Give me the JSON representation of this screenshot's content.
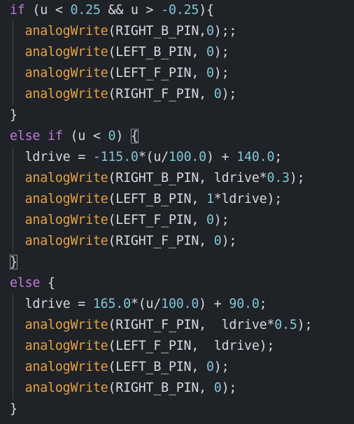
{
  "lines": [
    [
      {
        "t": "if",
        "c": "kw"
      },
      {
        "t": " (u < ",
        "c": "plain"
      },
      {
        "t": "0.25",
        "c": "num"
      },
      {
        "t": " && u > ",
        "c": "plain"
      },
      {
        "t": "-0.25",
        "c": "num"
      },
      {
        "t": "){",
        "c": "plain"
      }
    ],
    [
      {
        "t": "  ",
        "c": "plain"
      },
      {
        "t": "analogWrite",
        "c": "fn"
      },
      {
        "t": "(RIGHT_B_PIN,",
        "c": "plain"
      },
      {
        "t": "0",
        "c": "num"
      },
      {
        "t": ");;",
        "c": "plain"
      }
    ],
    [
      {
        "t": "  ",
        "c": "plain"
      },
      {
        "t": "analogWrite",
        "c": "fn"
      },
      {
        "t": "(LEFT_B_PIN, ",
        "c": "plain"
      },
      {
        "t": "0",
        "c": "num"
      },
      {
        "t": ");",
        "c": "plain"
      }
    ],
    [
      {
        "t": "  ",
        "c": "plain"
      },
      {
        "t": "analogWrite",
        "c": "fn"
      },
      {
        "t": "(LEFT_F_PIN, ",
        "c": "plain"
      },
      {
        "t": "0",
        "c": "num"
      },
      {
        "t": ");",
        "c": "plain"
      }
    ],
    [
      {
        "t": "  ",
        "c": "plain"
      },
      {
        "t": "analogWrite",
        "c": "fn"
      },
      {
        "t": "(RIGHT_F_PIN, ",
        "c": "plain"
      },
      {
        "t": "0",
        "c": "num"
      },
      {
        "t": ");",
        "c": "plain"
      }
    ],
    [
      {
        "t": "}",
        "c": "plain"
      }
    ],
    [
      {
        "t": "else",
        "c": "kw"
      },
      {
        "t": " ",
        "c": "plain"
      },
      {
        "t": "if",
        "c": "kw"
      },
      {
        "t": " (u < ",
        "c": "plain"
      },
      {
        "t": "0",
        "c": "num"
      },
      {
        "t": ") ",
        "c": "plain"
      },
      {
        "t": "{",
        "c": "plain",
        "m": true
      }
    ],
    [
      {
        "t": "  ldrive = ",
        "c": "plain"
      },
      {
        "t": "-115.0",
        "c": "num"
      },
      {
        "t": "*(u/",
        "c": "plain"
      },
      {
        "t": "100.0",
        "c": "num"
      },
      {
        "t": ") + ",
        "c": "plain"
      },
      {
        "t": "140.0",
        "c": "num"
      },
      {
        "t": ";",
        "c": "plain"
      }
    ],
    [
      {
        "t": "  ",
        "c": "plain"
      },
      {
        "t": "analogWrite",
        "c": "fn"
      },
      {
        "t": "(RIGHT_B_PIN, ldrive*",
        "c": "plain"
      },
      {
        "t": "0.3",
        "c": "num"
      },
      {
        "t": ");",
        "c": "plain"
      }
    ],
    [
      {
        "t": "  ",
        "c": "plain"
      },
      {
        "t": "analogWrite",
        "c": "fn"
      },
      {
        "t": "(LEFT_B_PIN, ",
        "c": "plain"
      },
      {
        "t": "1",
        "c": "num"
      },
      {
        "t": "*ldrive);",
        "c": "plain"
      }
    ],
    [
      {
        "t": "  ",
        "c": "plain"
      },
      {
        "t": "analogWrite",
        "c": "fn"
      },
      {
        "t": "(LEFT_F_PIN, ",
        "c": "plain"
      },
      {
        "t": "0",
        "c": "num"
      },
      {
        "t": ");",
        "c": "plain"
      }
    ],
    [
      {
        "t": "  ",
        "c": "plain"
      },
      {
        "t": "analogWrite",
        "c": "fn"
      },
      {
        "t": "(RIGHT_F_PIN, ",
        "c": "plain"
      },
      {
        "t": "0",
        "c": "num"
      },
      {
        "t": ");",
        "c": "plain"
      }
    ],
    [
      {
        "t": "}",
        "c": "plain",
        "m": true
      }
    ],
    [
      {
        "t": "else",
        "c": "kw"
      },
      {
        "t": " {",
        "c": "plain"
      }
    ],
    [
      {
        "t": "  ldrive = ",
        "c": "plain"
      },
      {
        "t": "165.0",
        "c": "num"
      },
      {
        "t": "*(u/",
        "c": "plain"
      },
      {
        "t": "100.0",
        "c": "num"
      },
      {
        "t": ") + ",
        "c": "plain"
      },
      {
        "t": "90.0",
        "c": "num"
      },
      {
        "t": ";",
        "c": "plain"
      }
    ],
    [
      {
        "t": "  ",
        "c": "plain"
      },
      {
        "t": "analogWrite",
        "c": "fn"
      },
      {
        "t": "(RIGHT_F_PIN,  ldrive*",
        "c": "plain"
      },
      {
        "t": "0.5",
        "c": "num"
      },
      {
        "t": ");",
        "c": "plain"
      }
    ],
    [
      {
        "t": "  ",
        "c": "plain"
      },
      {
        "t": "analogWrite",
        "c": "fn"
      },
      {
        "t": "(LEFT_F_PIN,  ldrive);",
        "c": "plain"
      }
    ],
    [
      {
        "t": "  ",
        "c": "plain"
      },
      {
        "t": "analogWrite",
        "c": "fn"
      },
      {
        "t": "(LEFT_B_PIN, ",
        "c": "plain"
      },
      {
        "t": "0",
        "c": "num"
      },
      {
        "t": ");",
        "c": "plain"
      }
    ],
    [
      {
        "t": "  ",
        "c": "plain"
      },
      {
        "t": "analogWrite",
        "c": "fn"
      },
      {
        "t": "(RIGHT_B_PIN, ",
        "c": "plain"
      },
      {
        "t": "0",
        "c": "num"
      },
      {
        "t": ");",
        "c": "plain"
      }
    ],
    [
      {
        "t": "}",
        "c": "plain"
      }
    ]
  ],
  "colors": {
    "background": "#1f2227",
    "keyword": "#c678dd",
    "function": "#e5a244",
    "number": "#7fc6d6",
    "text": "#d7dae0"
  }
}
